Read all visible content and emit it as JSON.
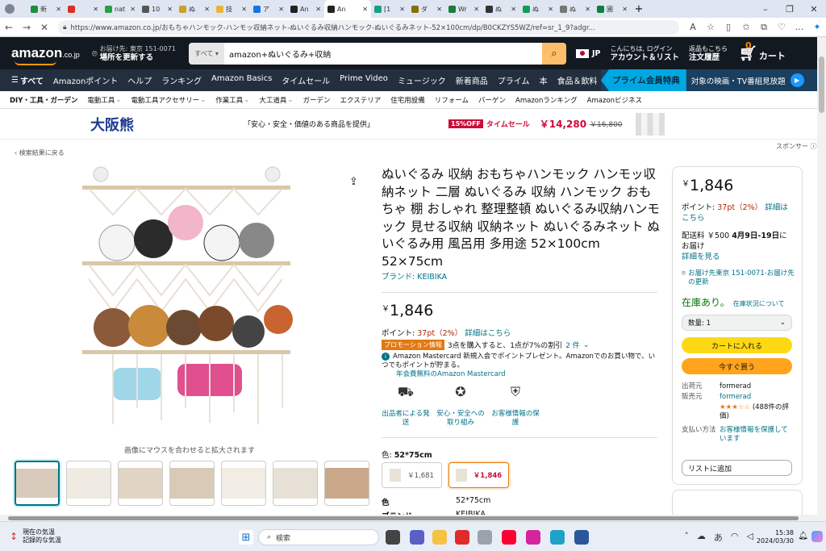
{
  "browser": {
    "tabs": [
      "新",
      "",
      "nat",
      "10",
      "ぬ",
      "技",
      "ア",
      "An",
      "An",
      "[1",
      "ダ",
      "Wr",
      "ぬ",
      "ぬ",
      "ぬ",
      "圃"
    ],
    "active_tab_index": 8,
    "url": "https://www.amazon.co.jp/おもちゃハンモック-ハンモッ収納ネット-ぬいぐるみ収納ハンモック-ぬいぐるみネット-52×100cm/dp/B0CKZYS5WZ/ref=sr_1_9?adgr..."
  },
  "header": {
    "logo": "amazon",
    "logo_suffix": ".co.jp",
    "deliver_line1": "お届け先: 東京 151-0071",
    "deliver_line2": "場所を更新する",
    "search_category": "すべて",
    "search_query": "amazon+ぬいぐるみ+収納",
    "lang": "JP",
    "account_line1": "こんにちは, ログイン",
    "account_line2": "アカウント＆リスト",
    "orders_line1": "返品もこちら",
    "orders_line2": "注文履歴",
    "cart_count": "0",
    "cart_label": "カート"
  },
  "subnav": {
    "items": [
      "すべて",
      "Amazonポイント",
      "ヘルプ",
      "ランキング",
      "Amazon Basics",
      "タイムセール",
      "Prime Video",
      "ミュージック",
      "新着商品",
      "プライム",
      "本",
      "食品＆飲料"
    ],
    "prime_banner": "プライム会員特典",
    "prime_text": "対象の映画・TV番組見放題"
  },
  "category_bar": [
    "DIY・工具・ガーデン",
    "電動工具",
    "電動工具アクセサリー",
    "作業工具",
    "大工道具",
    "ガーデン",
    "エクステリア",
    "住宅用設備",
    "リフォーム",
    "バーゲン",
    "Amazonランキング",
    "Amazonビジネス"
  ],
  "ad": {
    "brand": "大阪熊",
    "text": "「安心・安全・価値のある商品を提供」",
    "badge": "15%OFF",
    "sale": "タイムセール",
    "price": "￥14,280",
    "old_price": "￥16,800",
    "sponsor": "スポンサー"
  },
  "back_link": "‹ 検索結果に戻る",
  "gallery": {
    "zoom_hint": "画像にマウスを合わせると拡大されます",
    "thumbnails": 7
  },
  "product": {
    "title": "ぬいぐるみ 収納 おもちゃハンモック ハンモッ収納ネット 二層 ぬいぐるみ 収納 ハンモック おもちゃ 棚 おしゃれ 整理整頓 ぬいぐるみ収納ハンモック 見せる収納 収納ネット ぬいぐるみネット ぬいぐるみ用 風呂用 多用途 52×100cm 52×75cm",
    "brand": "ブランド: KEIBIKA",
    "currency": "￥",
    "price": "1,846",
    "points_label": "ポイント:",
    "points_value": "37pt（2%）",
    "points_link": "詳細はこちら",
    "promo_tag": "プロモーション情報",
    "promo_text": "3点を購入すると、1点が7%の割引",
    "promo_count": "2 件",
    "mc_text": "Amazon Mastercard 新規入会でポイントプレゼント。Amazonでのお買い物で、いつでもポイントが貯まる。",
    "mc_link": "年会費無料のAmazon Mastercard",
    "features": [
      "出品者による発送",
      "安心・安全への取り組み",
      "お客様情報の保護"
    ],
    "color_label": "色:",
    "color_value": "52*75cm",
    "variants": [
      {
        "price": "￥1,681",
        "selected": false
      },
      {
        "price": "￥1,846",
        "selected": true
      }
    ],
    "specs": [
      {
        "key": "色",
        "value": "52*75cm"
      },
      {
        "key": "ブランド",
        "value": "KEIBIKA"
      }
    ]
  },
  "buybox": {
    "currency": "￥",
    "price": "1,846",
    "points_label": "ポイント:",
    "points_value": "37pt（2%）",
    "points_link": "詳細はこちら",
    "ship_label": "配送料 ￥500",
    "ship_date": "4月9日-19日",
    "ship_tail": "にお届け",
    "ship_link": "詳細を見る",
    "address": "お届け先東京 151-0071-お届け先の更新",
    "stock": "在庫あり。",
    "stock_link": "在庫状況について",
    "qty": "数量: 1",
    "add_cart": "カートに入れる",
    "buy_now": "今すぐ買う",
    "shipper_label": "出荷元",
    "shipper": "formerad",
    "seller_label": "販売元",
    "seller": "formerad",
    "rating_stars": "★★★☆☆",
    "rating_count": "(488件の評価)",
    "payment_label": "支払い方法",
    "payment_link": "お客様情報を保護しています",
    "wishlist": "リストに追加"
  },
  "taskbar": {
    "weather_line1": "現在の気温",
    "weather_line2": "記録的な気温",
    "search_placeholder": "検索",
    "ime": "あ",
    "time": "15:38",
    "date": "2024/03/30"
  },
  "colors": {
    "amazon_dark": "#131921",
    "amazon_nav": "#232f3e",
    "accent_orange": "#ff9900",
    "link_teal": "#007185",
    "cart_yellow": "#ffd814",
    "buy_orange": "#ffa41c"
  }
}
